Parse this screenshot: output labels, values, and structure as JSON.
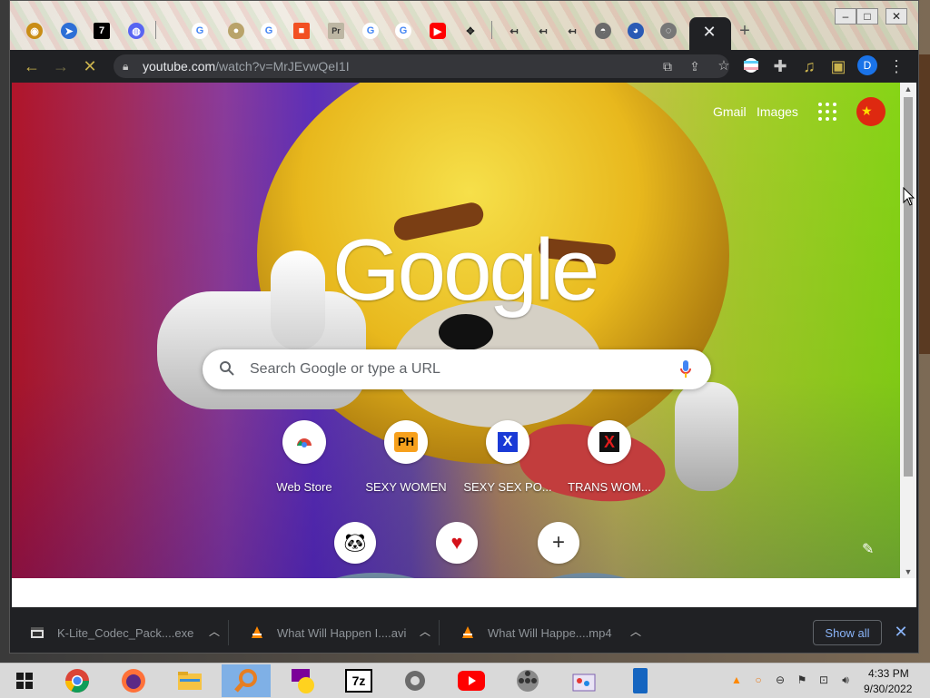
{
  "browser": {
    "url_host": "youtube.com",
    "url_path": "/watch?v=MrJEvwQeI1I",
    "profile_initial": "D"
  },
  "ntp": {
    "links": {
      "gmail": "Gmail",
      "images": "Images"
    },
    "logo": "Google",
    "search_placeholder": "Search Google or type a URL",
    "shortcuts": [
      {
        "label": "Web Store",
        "icon": "webstore-icon"
      },
      {
        "label": "SEXY WOMEN",
        "icon": "ph-icon",
        "icon_text": "PH"
      },
      {
        "label": "SEXY SEX PO...",
        "icon": "x-blue-icon",
        "icon_text": "X"
      },
      {
        "label": "TRANS WOM...",
        "icon": "x-red-icon",
        "icon_text": "X"
      }
    ],
    "row2_shortcuts": [
      {
        "icon": "panda-icon"
      },
      {
        "icon": "heart-icon"
      },
      {
        "icon": "add-shortcut-icon"
      }
    ]
  },
  "downloads": {
    "items": [
      {
        "name": "K-Lite_Codec_Pack....exe",
        "icon": "installer-icon"
      },
      {
        "name": "What Will Happen I....avi",
        "icon": "vlc-icon"
      },
      {
        "name": "What Will Happe....mp4",
        "icon": "vlc-icon"
      }
    ],
    "show_all": "Show all"
  },
  "taskbar": {
    "time": "4:33 PM",
    "date": "9/30/2022"
  },
  "colors": {
    "accent": "#8ab4f8",
    "chrome_dark": "#202124",
    "flag_red": "#de2910",
    "taskbar_active": "#7fb0e6"
  }
}
